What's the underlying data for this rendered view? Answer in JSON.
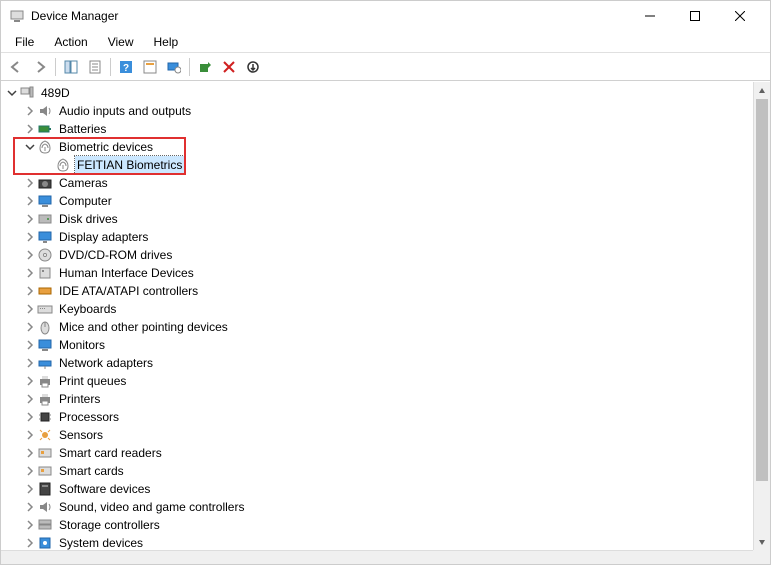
{
  "window": {
    "title": "Device Manager"
  },
  "menubar": [
    "File",
    "Action",
    "View",
    "Help"
  ],
  "toolbar": {
    "back": "Back",
    "forward": "Forward",
    "showhide": "Show/hide console tree",
    "properties": "Properties",
    "help": "Help",
    "refresh": "Refresh",
    "scan": "Scan for hardware changes",
    "uninstall": "Uninstall device",
    "disable": "Disable device",
    "update": "Update driver"
  },
  "tree": {
    "root": {
      "label": "489D",
      "expanded": true
    },
    "items": [
      {
        "label": "Audio inputs and outputs",
        "expanded": false,
        "icon": "audio"
      },
      {
        "label": "Batteries",
        "expanded": false,
        "icon": "battery"
      },
      {
        "label": "Biometric devices",
        "expanded": true,
        "icon": "biometric",
        "children": [
          {
            "label": "FEITIAN Biometrics",
            "selected": true,
            "icon": "biometric"
          }
        ]
      },
      {
        "label": "Cameras",
        "expanded": false,
        "icon": "camera"
      },
      {
        "label": "Computer",
        "expanded": false,
        "icon": "computer"
      },
      {
        "label": "Disk drives",
        "expanded": false,
        "icon": "disk"
      },
      {
        "label": "Display adapters",
        "expanded": false,
        "icon": "display"
      },
      {
        "label": "DVD/CD-ROM drives",
        "expanded": false,
        "icon": "dvd"
      },
      {
        "label": "Human Interface Devices",
        "expanded": false,
        "icon": "hid"
      },
      {
        "label": "IDE ATA/ATAPI controllers",
        "expanded": false,
        "icon": "ide"
      },
      {
        "label": "Keyboards",
        "expanded": false,
        "icon": "keyboard"
      },
      {
        "label": "Mice and other pointing devices",
        "expanded": false,
        "icon": "mouse"
      },
      {
        "label": "Monitors",
        "expanded": false,
        "icon": "monitor"
      },
      {
        "label": "Network adapters",
        "expanded": false,
        "icon": "network"
      },
      {
        "label": "Print queues",
        "expanded": false,
        "icon": "printer"
      },
      {
        "label": "Printers",
        "expanded": false,
        "icon": "printer"
      },
      {
        "label": "Processors",
        "expanded": false,
        "icon": "cpu"
      },
      {
        "label": "Sensors",
        "expanded": false,
        "icon": "sensor"
      },
      {
        "label": "Smart card readers",
        "expanded": false,
        "icon": "smartcard"
      },
      {
        "label": "Smart cards",
        "expanded": false,
        "icon": "smartcard"
      },
      {
        "label": "Software devices",
        "expanded": false,
        "icon": "software"
      },
      {
        "label": "Sound, video and game controllers",
        "expanded": false,
        "icon": "sound"
      },
      {
        "label": "Storage controllers",
        "expanded": false,
        "icon": "storage"
      },
      {
        "label": "System devices",
        "expanded": false,
        "icon": "system"
      }
    ]
  }
}
